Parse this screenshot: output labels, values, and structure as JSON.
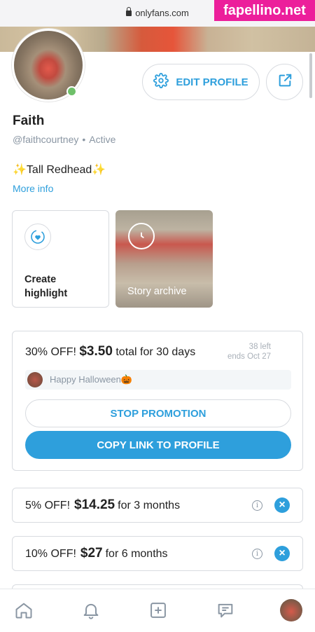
{
  "browser": {
    "url": "onlyfans.com",
    "watermark": "fapellino.net"
  },
  "profile": {
    "name": "Faith",
    "handle": "@faithcourtney",
    "status_separator": "•",
    "status": "Active",
    "bio_spark": "✨",
    "bio_text": "Tall Redhead",
    "more_info_label": "More info",
    "edit_profile_label": "EDIT PROFILE"
  },
  "highlights": {
    "create_label_line1": "Create",
    "create_label_line2": "highlight",
    "archive_label": "Story archive"
  },
  "promotion": {
    "discount": "30% OFF!",
    "price": "$3.50",
    "terms": "total for 30 days",
    "left": "38 left",
    "ends": "ends Oct 27",
    "message": "Happy Halloween🎃",
    "stop_label": "STOP PROMOTION",
    "copy_label": "COPY LINK TO PROFILE"
  },
  "bundles": [
    {
      "discount": "5% OFF!",
      "price": "$14.25",
      "duration": "for 3 months"
    },
    {
      "discount": "10% OFF!",
      "price": "$27",
      "duration": "for 6 months"
    }
  ],
  "icons": {
    "info": "i",
    "close": "×"
  },
  "colors": {
    "accent": "#2e9fdc",
    "online": "#6fc06a",
    "watermark_bg": "#ec1f9b"
  }
}
